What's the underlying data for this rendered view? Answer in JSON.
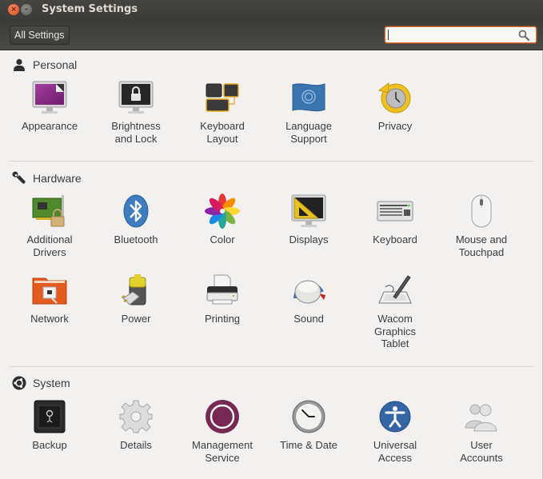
{
  "window": {
    "title": "System Settings",
    "close_glyph": "×",
    "minimize_glyph": "–"
  },
  "toolbar": {
    "all_settings_label": "All Settings",
    "search": {
      "value": "",
      "placeholder": "",
      "icon": "search-icon"
    }
  },
  "colors": {
    "accent_orange": "#e36b2a",
    "titlebar": "#3c3b37",
    "background": "#f2f1f0",
    "ubuntu_aubergine": "#772953"
  },
  "sections": [
    {
      "title": "Personal",
      "icon": "person-icon",
      "items": [
        {
          "label": "Appearance",
          "icon": "appearance-icon"
        },
        {
          "label": "Brightness\nand Lock",
          "icon": "brightness-lock-icon"
        },
        {
          "label": "Keyboard\nLayout",
          "icon": "keyboard-layout-icon"
        },
        {
          "label": "Language\nSupport",
          "icon": "language-flag-icon"
        },
        {
          "label": "Privacy",
          "icon": "privacy-icon"
        }
      ]
    },
    {
      "title": "Hardware",
      "icon": "wrench-icon",
      "items": [
        {
          "label": "Additional\nDrivers",
          "icon": "drivers-card-icon"
        },
        {
          "label": "Bluetooth",
          "icon": "bluetooth-icon"
        },
        {
          "label": "Color",
          "icon": "color-flower-icon"
        },
        {
          "label": "Displays",
          "icon": "displays-icon"
        },
        {
          "label": "Keyboard",
          "icon": "keyboard-icon"
        },
        {
          "label": "Mouse and\nTouchpad",
          "icon": "mouse-icon"
        },
        {
          "label": "Network",
          "icon": "network-folder-icon"
        },
        {
          "label": "Power",
          "icon": "battery-plug-icon"
        },
        {
          "label": "Printing",
          "icon": "printer-icon"
        },
        {
          "label": "Sound",
          "icon": "volume-knob-icon"
        },
        {
          "label": "Wacom\nGraphics\nTablet",
          "icon": "tablet-pen-icon"
        }
      ]
    },
    {
      "title": "System",
      "icon": "ubuntu-logo-icon",
      "items": [
        {
          "label": "Backup",
          "icon": "safe-icon"
        },
        {
          "label": "Details",
          "icon": "gear-icon"
        },
        {
          "label": "Management\nService",
          "icon": "management-ring-icon"
        },
        {
          "label": "Time & Date",
          "icon": "clock-icon"
        },
        {
          "label": "Universal\nAccess",
          "icon": "accessibility-icon"
        },
        {
          "label": "User\nAccounts",
          "icon": "users-icon"
        }
      ]
    }
  ]
}
